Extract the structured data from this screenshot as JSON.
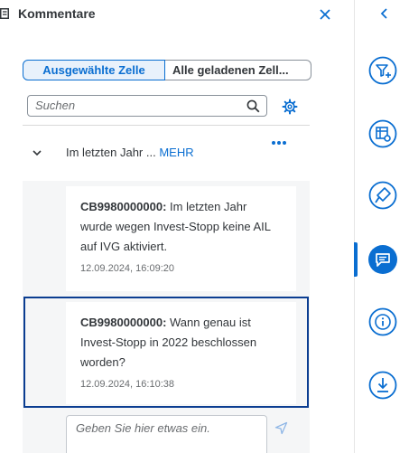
{
  "header": {
    "title": "Kommentare"
  },
  "tabs": [
    {
      "label": "Ausgewählte Zelle",
      "active": true
    },
    {
      "label": "Alle geladenen Zell...",
      "active": false
    }
  ],
  "search": {
    "placeholder": "Suchen"
  },
  "thread": {
    "preview": "Im letzten Jahr ... ",
    "more": "MEHR"
  },
  "comments": [
    {
      "author": "CB9980000000:",
      "text": " Im letzten Jahr wurde wegen Invest-Stopp keine AIL auf IVG aktiviert.",
      "time": "12.09.2024, 16:09:20"
    },
    {
      "author": "CB9980000000:",
      "text": " Wann genau ist Invest-Stopp in 2022 beschlossen worden?",
      "time": "12.09.2024, 16:10:38"
    }
  ],
  "reply": {
    "placeholder": "Geben Sie hier etwas ein."
  },
  "sidebar": {
    "icons": [
      "filter-add-icon",
      "table-settings-icon",
      "style-brush-icon",
      "comment-icon",
      "info-icon",
      "download-icon"
    ],
    "active": "comment-icon"
  },
  "colors": {
    "accent": "#0a6ed1",
    "selected_border": "#0b3d91",
    "text": "#32363a",
    "muted": "#6a6d70",
    "area_bg": "#f5f6f7"
  }
}
